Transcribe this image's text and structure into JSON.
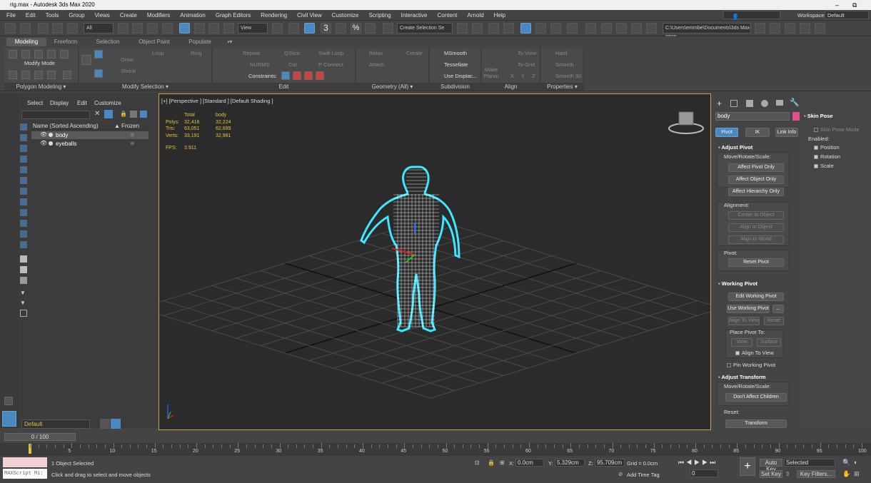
{
  "window": {
    "title": "rig.max - Autodesk 3ds Max 2020",
    "min": "–",
    "max": "⧉"
  },
  "menu": [
    "File",
    "Edit",
    "Tools",
    "Group",
    "Views",
    "Create",
    "Modifiers",
    "Animation",
    "Graph Editors",
    "Rendering",
    "Civil View",
    "Customize",
    "Scripting",
    "Interactive",
    "Content",
    "Arnold",
    "Help"
  ],
  "user": "emmbea24",
  "workspaces_label": "Workspaces:",
  "workspace": "Default",
  "toolbar": {
    "filter": "All",
    "view": "View",
    "selection_set": "Create Selection Se",
    "project_path": "C:\\Users\\emmbe\\Documents\\3ds Max 2020",
    "pct": "%",
    "three": "3",
    "two": "2"
  },
  "ribbon": {
    "tabs": [
      "Modeling",
      "Freeform",
      "Selection",
      "Object Paint",
      "Populate"
    ],
    "modify_mode": "Modify Mode",
    "polygon_modeling": "Polygon Modeling ▾",
    "modify_selection": "Modify Selection ▾",
    "grow": "Grow",
    "shrink": "Shrink",
    "loop": "Loop",
    "ring": "Ring",
    "repeat": "Repeat",
    "qslice": "QSlice",
    "swift_loop": "Swift Loop",
    "nurms": "NURMS",
    "cut": "Cut",
    "p_connect": "P Connect",
    "constraints": "Constraints:",
    "edit": "Edit",
    "relax": "Relax",
    "create": "Create",
    "attach": "Attach",
    "geometry_all": "Geometry (All) ▾",
    "msmooth": "MSmooth",
    "tessellate": "Tessellate",
    "use_displac": "Use Displac...",
    "subdivision": "Subdivision",
    "make_planar": "Make Planar",
    "to_view": "To View",
    "to_grid": "To Grid",
    "x": "X",
    "y": "Y",
    "z": "Z",
    "align": "Align",
    "hard": "Hard",
    "smooth": "Smooth",
    "smooth30": "Smooth 30",
    "properties": "Properties ▾"
  },
  "scene_explorer": {
    "menu": [
      "Select",
      "Display",
      "Edit",
      "Customize"
    ],
    "col_name": "Name (Sorted Ascending)",
    "col_frozen": "▲ Frozen",
    "rows": [
      "body",
      "eyeballs"
    ]
  },
  "viewport": {
    "label": "[+] [Perspective ] [Standard ] [Default Shading ]",
    "stats_header": [
      "",
      "Total",
      "body"
    ],
    "stats": [
      [
        "Polys:",
        "32,416",
        "32,224"
      ],
      [
        "Tris:",
        "63,051",
        "62,699"
      ],
      [
        "Verts:",
        "33,191",
        "32,981"
      ]
    ],
    "fps_label": "FPS:",
    "fps": "3.911"
  },
  "command_panel": {
    "object_name": "body",
    "tabs": [
      "Pivot",
      "IK",
      "Link Info"
    ],
    "adjust_pivot": "Adjust Pivot",
    "move_rotate_scale": "Move/Rotate/Scale:",
    "affect_pivot": "Affect Pivot Only",
    "affect_object": "Affect Object Only",
    "affect_hierarchy": "Affect Hierarchy Only",
    "alignment": "Alignment:",
    "center_to_object": "Center to Object",
    "align_to_object": "Align to Object",
    "align_to_world": "Align to World",
    "pivot": "Pivot:",
    "reset_pivot": "Reset Pivot",
    "working_pivot": "Working Pivot",
    "edit_working_pivot": "Edit Working Pivot",
    "use_working_pivot": "Use Working Pivot",
    "dots": "...",
    "align_to_view": "Align To View",
    "reset": "Reset",
    "place_pivot_to": "Place Pivot To:",
    "view": "View",
    "surface": "Surface",
    "align_to_view_cb": "Align To View",
    "pin_working_pivot": "Pin Working Pivot",
    "adjust_transform": "Adjust Transform",
    "move_rotate_scale2": "Move/Rotate/Scale:",
    "dont_affect_children": "Don't Affect Children",
    "reset2": "Reset:",
    "transform": "Transform"
  },
  "skin_pose": {
    "title": "Skin Pose",
    "mode": "Skin Pose Mode",
    "enabled": "Enabled:",
    "items": [
      "Position",
      "Rotation",
      "Scale"
    ]
  },
  "layer": "Default",
  "timeline": {
    "frame": "0 / 100",
    "ticks": [
      "5",
      "10",
      "15",
      "20",
      "25",
      "30",
      "35",
      "40",
      "45",
      "50",
      "55",
      "60",
      "65",
      "70",
      "75",
      "80",
      "85",
      "90",
      "95",
      "100"
    ]
  },
  "status": {
    "script_label": "MAXScript Mi:",
    "selected": "1 Object Selected",
    "hint": "Click and drag to select and move objects",
    "x_label": "X:",
    "x": "0.0cm",
    "y_label": "Y:",
    "y": "5.329cm",
    "z_label": "Z:",
    "z": "95.709cm",
    "grid": "Grid = 0.0cm",
    "add_time_tag": "Add Time Tag",
    "auto_key": "Auto Key",
    "set_key": "Set Key",
    "selected_dd": "Selected",
    "key_filters": "Key Filters...",
    "frame_val": "0"
  },
  "colors": {
    "accent": "#4a88c2",
    "viewport_border": "#c7a54d",
    "mesh": "#ffffff",
    "outline": "#3fe6ff",
    "object_color": "#e0508f"
  }
}
